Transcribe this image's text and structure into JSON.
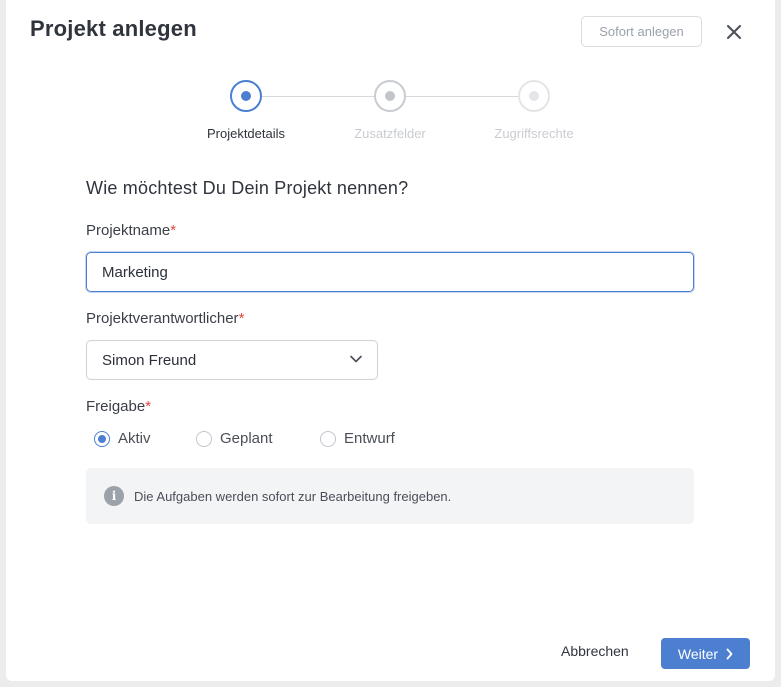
{
  "dialog": {
    "title": "Projekt anlegen",
    "instant_button": "Sofort anlegen"
  },
  "stepper": {
    "steps": [
      {
        "label": "Projektdetails",
        "state": "active"
      },
      {
        "label": "Zusatzfelder",
        "state": "inactive"
      },
      {
        "label": "Zugriffsrechte",
        "state": "disabled"
      }
    ]
  },
  "form": {
    "question": "Wie möchtest Du Dein Projekt nennen?",
    "project_name": {
      "label": "Projektname",
      "required_mark": "*",
      "value": "Marketing"
    },
    "owner": {
      "label": "Projektverantwortlicher",
      "required_mark": "*",
      "value": "Simon Freund"
    },
    "release": {
      "label": "Freigabe",
      "required_mark": "*",
      "options": [
        {
          "label": "Aktiv",
          "checked": true
        },
        {
          "label": "Geplant",
          "checked": false
        },
        {
          "label": "Entwurf",
          "checked": false
        }
      ]
    },
    "info": {
      "icon": "info-icon",
      "icon_glyph": "i",
      "text": "Die Aufgaben werden sofort zur Bearbeitung freigeben."
    }
  },
  "footer": {
    "cancel_label": "Abbrechen",
    "next_label": "Weiter"
  },
  "colors": {
    "accent": "#4d7fd1",
    "required": "#e0473d"
  }
}
